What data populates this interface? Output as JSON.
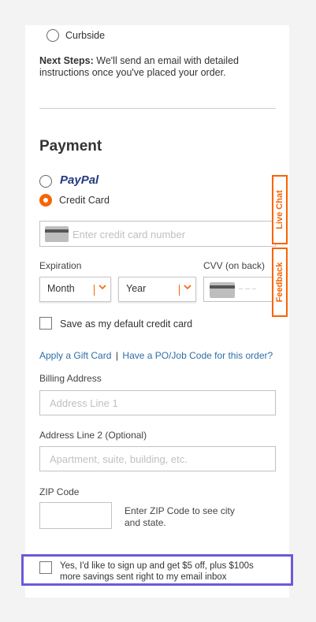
{
  "delivery": {
    "curbside_label": "Curbside",
    "next_steps_label": "Next Steps:",
    "next_steps_text": " We'll send an email with detailed instructions once you've placed your order."
  },
  "payment": {
    "heading": "Payment",
    "paypal_label": "PayPal",
    "credit_card_label": "Credit Card",
    "card_number_placeholder": "Enter credit card number",
    "expiration_label": "Expiration",
    "month_value": "Month",
    "year_value": "Year",
    "cvv_label": "CVV (on back)",
    "cvv_placeholder": "– – –",
    "save_default_label": "Save as my default credit card",
    "gift_card_link": "Apply a Gift Card",
    "link_separator": "|",
    "po_code_link": "Have a PO/Job Code for this order?"
  },
  "billing": {
    "billing_address_label": "Billing Address",
    "address1_placeholder": "Address Line 1",
    "address2_label": "Address Line 2 (Optional)",
    "address2_placeholder": "Apartment, suite, building, etc.",
    "zip_label": "ZIP Code",
    "zip_hint": "Enter ZIP Code to see city and state."
  },
  "side_tabs": {
    "live_chat": "Live Chat",
    "feedback": "Feedback"
  },
  "signup": {
    "text": "Yes, I'd like to sign up and get $5 off, plus $100s more savings sent right to my email inbox"
  },
  "colors": {
    "accent": "#f96302",
    "link": "#2f6ea5",
    "highlight": "#6a5ad8",
    "paypal_dark": "#253b80",
    "paypal_light": "#179bd7"
  }
}
